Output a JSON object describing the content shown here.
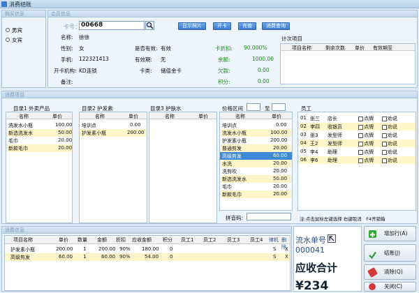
{
  "window": {
    "title": "消费结账"
  },
  "shop_info": {
    "title": "购买信息",
    "options": [
      "男宾",
      "女宾"
    ]
  },
  "member": {
    "title": "会员信息",
    "card_label": "卡号：",
    "card_value": "00668",
    "buttons": [
      "显示照片",
      "开卡",
      "充值",
      "消费查询"
    ],
    "name_label": "名称:",
    "name_value": "徐徐",
    "gender_label": "性别:",
    "gender_value": "女",
    "valid_label": "是否有效:",
    "valid_value": "有效",
    "discount_label": "卡折扣:",
    "discount_value": "90.000%",
    "phone_label": "手机:",
    "phone_value": "122321413",
    "expiry_label": "有效期:",
    "expiry_value": "无",
    "balance_label": "余额:",
    "balance_value": "1000.00",
    "open_label": "开卡机构:",
    "open_value": "KD连锁",
    "cardtype_label": "卡类:",
    "cardtype_value": "储值金卡",
    "owed_label": "欠款:",
    "owed_value": "0.00",
    "note_label": "备注:",
    "points_label": "积分:",
    "points_value": "0.00",
    "count_title": "计次项目",
    "count_headers": [
      "项目名称",
      "剩余次数",
      "单价",
      "有效期至"
    ]
  },
  "consume": {
    "title": "消费项目",
    "cat1": {
      "label": "目录1 外卖产品",
      "headers": [
        "名称",
        "单价"
      ],
      "rows": [
        [
          "洗发水小瓶",
          "100.00"
        ],
        [
          "新选洗发水",
          "50.00"
        ],
        [
          "毛巾",
          "20.00"
        ],
        [
          "新款毛巾",
          "20.00"
        ]
      ]
    },
    "cat2": {
      "label": "目录2 护发素",
      "headers": [
        "名称",
        "单价"
      ],
      "rows": [
        [
          "培训点",
          "0.00"
        ],
        [
          "护发素小瓶",
          "200.00"
        ]
      ]
    },
    "cat3": {
      "label": "目录3 护肤水",
      "headers": [
        "名称",
        "单价"
      ],
      "rows": []
    },
    "price": {
      "label": "价格区间",
      "to": "至",
      "headers": [
        "名称",
        "单价"
      ],
      "rows": [
        [
          "培训点",
          "0.00"
        ],
        [
          "洗发水小瓶",
          "100.00"
        ],
        [
          "护发素小瓶",
          "200.00"
        ],
        [
          "普通剪发",
          "20.00"
        ],
        [
          "高级剪发",
          "60.00"
        ],
        [
          "水洗",
          "20.00"
        ],
        [
          "洗剪吹",
          "20.00"
        ],
        [
          "新选洗发水",
          "50.00"
        ],
        [
          "毛巾",
          "20.00"
        ],
        [
          "新款毛巾",
          "20.00"
        ]
      ],
      "pinyin_label": "拼音码:"
    },
    "staff": {
      "label": "员工",
      "rows": [
        [
          "01",
          "张三",
          "店长",
          "点牌",
          "劝说"
        ],
        [
          "02",
          "李四",
          "收银员",
          "点牌",
          "劝说"
        ],
        [
          "03",
          "张3",
          "发型师",
          "点牌",
          "劝说"
        ],
        [
          "04",
          "王2",
          "发型师",
          "点牌",
          "劝说"
        ],
        [
          "05",
          "李4",
          "助理",
          "点牌",
          "劝说"
        ],
        [
          "06",
          "李6",
          "助理",
          "点牌",
          "劝说"
        ]
      ],
      "hint": "注:点击鼠标左键选择 右键取消　F4开锁箱"
    }
  },
  "detail": {
    "title": "消费信息",
    "headers": [
      "项目名称",
      "单价",
      "数量",
      "金额",
      "折扣",
      "应收金额",
      "积分",
      "员工1",
      "员工2",
      "员工3",
      "员工4",
      "律机",
      "删除"
    ],
    "rows": [
      [
        "护发素小瓶",
        "200.00",
        "1",
        "200.00",
        "90%",
        "180.00",
        "0",
        "",
        "",
        "",
        "",
        "S",
        "X"
      ],
      [
        "高级剪发",
        "60.00",
        "1",
        "60.00",
        "90%",
        "54.00",
        "0",
        "",
        "",
        "",
        "",
        "S",
        "X"
      ]
    ]
  },
  "summary": {
    "serial_label": "流水单号",
    "serial_value": "000041",
    "total_label": "应收合计",
    "total_value": "¥234"
  },
  "side_buttons": [
    "增加行(A)",
    "结账(J)",
    "清除(Q)",
    "关闭(C)"
  ]
}
